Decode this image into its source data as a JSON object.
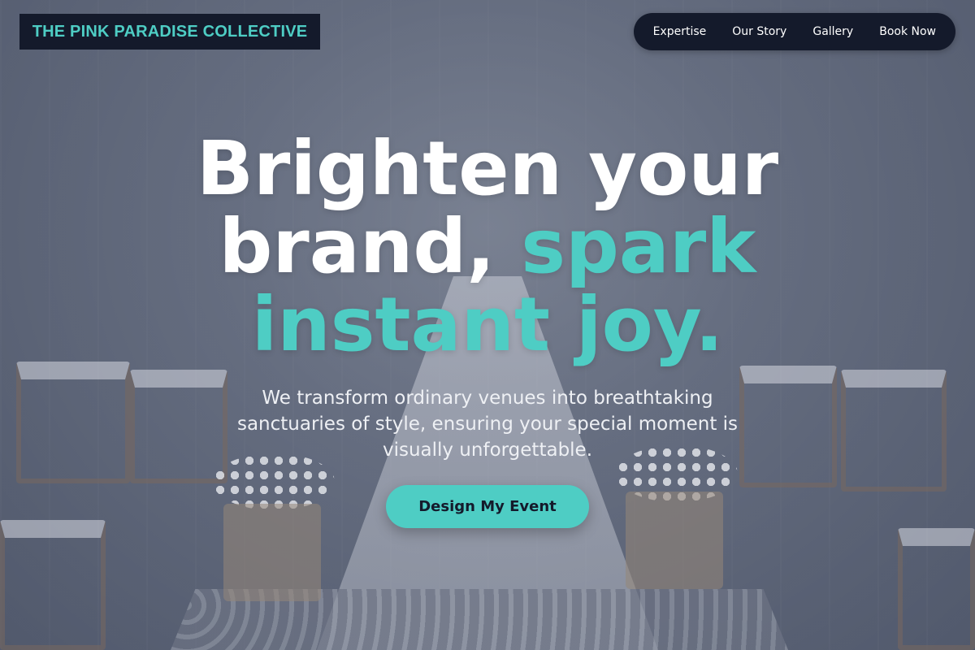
{
  "brand": {
    "logo_text": "THE PINK PARADISE COLLECTIVE"
  },
  "nav": {
    "items": [
      {
        "label": "Expertise"
      },
      {
        "label": "Our Story"
      },
      {
        "label": "Gallery"
      },
      {
        "label": "Book Now"
      }
    ]
  },
  "hero": {
    "headline_part1": "Brighten your",
    "headline_part2": "brand,",
    "headline_accent1": "spark",
    "headline_accent2": "instant joy.",
    "subtitle": "We transform ordinary venues into breathtaking sanctuaries of style, ensuring your special moment is visually unforgettable.",
    "cta_label": "Design My Event"
  },
  "colors": {
    "accent": "#4ecdc4",
    "dark": "#141a2b",
    "overlay": "#464e62"
  }
}
